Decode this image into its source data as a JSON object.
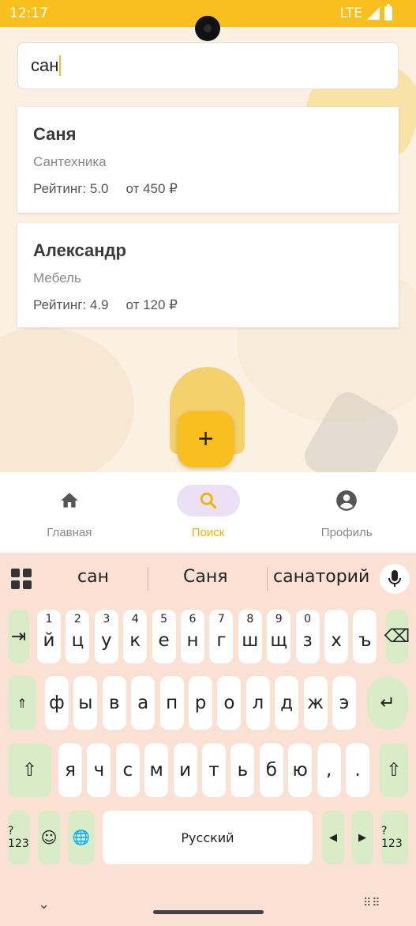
{
  "status": {
    "time": "12:17",
    "network": "LTE"
  },
  "search": {
    "value": "сан"
  },
  "results": [
    {
      "name": "Саня",
      "category": "Сантехника",
      "rating": "Рейтинг: 5.0",
      "price": "от 450 ₽"
    },
    {
      "name": "Александр",
      "category": "Мебель",
      "rating": "Рейтинг: 4.9",
      "price": "от 120 ₽"
    }
  ],
  "fab": {
    "label": "+"
  },
  "nav": [
    {
      "label": "Главная",
      "icon": "home-icon"
    },
    {
      "label": "Поиск",
      "icon": "search-icon",
      "active": true
    },
    {
      "label": "Профиль",
      "icon": "profile-icon"
    }
  ],
  "keyboard": {
    "suggestions": [
      "сан",
      "Саня",
      "санаторий"
    ],
    "row1": [
      {
        "k": "й",
        "n": "1"
      },
      {
        "k": "ц",
        "n": "2"
      },
      {
        "k": "у",
        "n": "3"
      },
      {
        "k": "к",
        "n": "4"
      },
      {
        "k": "е",
        "n": "5"
      },
      {
        "k": "н",
        "n": "6"
      },
      {
        "k": "г",
        "n": "7"
      },
      {
        "k": "ш",
        "n": "8"
      },
      {
        "k": "щ",
        "n": "9"
      },
      {
        "k": "з",
        "n": "0"
      },
      {
        "k": "х",
        "n": ""
      },
      {
        "k": "ъ",
        "n": ""
      }
    ],
    "row2": [
      "ф",
      "ы",
      "в",
      "а",
      "п",
      "р",
      "о",
      "л",
      "д",
      "ж",
      "э"
    ],
    "row3": [
      "я",
      "ч",
      "с",
      "м",
      "и",
      "т",
      "ь",
      "б",
      "ю",
      ",",
      "."
    ],
    "tab_key": "⇥",
    "backspace_key": "⌫",
    "caps_key": "⇑",
    "enter_key": "↵",
    "shift_key": "⇧",
    "symbols_key": "?123",
    "emoji_key": "☺",
    "globe_key": "🌐",
    "space_label": "Русский",
    "left_key": "◀",
    "right_key": "▶",
    "hide_key": "⌄",
    "keyboard_switch": "⠿⠿"
  }
}
